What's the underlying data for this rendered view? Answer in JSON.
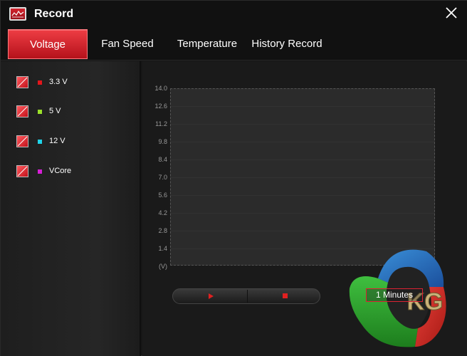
{
  "window": {
    "title": "Record",
    "close_icon": "close-icon"
  },
  "tabs": [
    {
      "label": "Voltage",
      "active": true
    },
    {
      "label": "Fan Speed",
      "active": false
    },
    {
      "label": "Temperature",
      "active": false
    },
    {
      "label": "History Record",
      "active": false
    }
  ],
  "legend": [
    {
      "label": "3.3 V",
      "color": "#e3161b",
      "checked": true
    },
    {
      "label": "5 V",
      "color": "#9ae02a",
      "checked": true
    },
    {
      "label": "12 V",
      "color": "#1fd3e8",
      "checked": true
    },
    {
      "label": "VCore",
      "color": "#d61fd6",
      "checked": true
    }
  ],
  "chart_data": {
    "type": "line",
    "yticks": [
      "14.0",
      "12.6",
      "11.2",
      "9.8",
      "8.4",
      "7.0",
      "5.6",
      "4.2",
      "2.8",
      "1.4",
      "(V)"
    ],
    "ylim": [
      0,
      14.0
    ],
    "series": [],
    "grid": true
  },
  "controls": {
    "play_icon": "play-icon",
    "stop_icon": "stop-icon"
  },
  "duration": {
    "value": "1 Minutes"
  },
  "watermark": {
    "text": "KG"
  },
  "colors": {
    "accent": "#e3161b",
    "background": "#161616",
    "plot_bg": "#2b2b2b"
  }
}
